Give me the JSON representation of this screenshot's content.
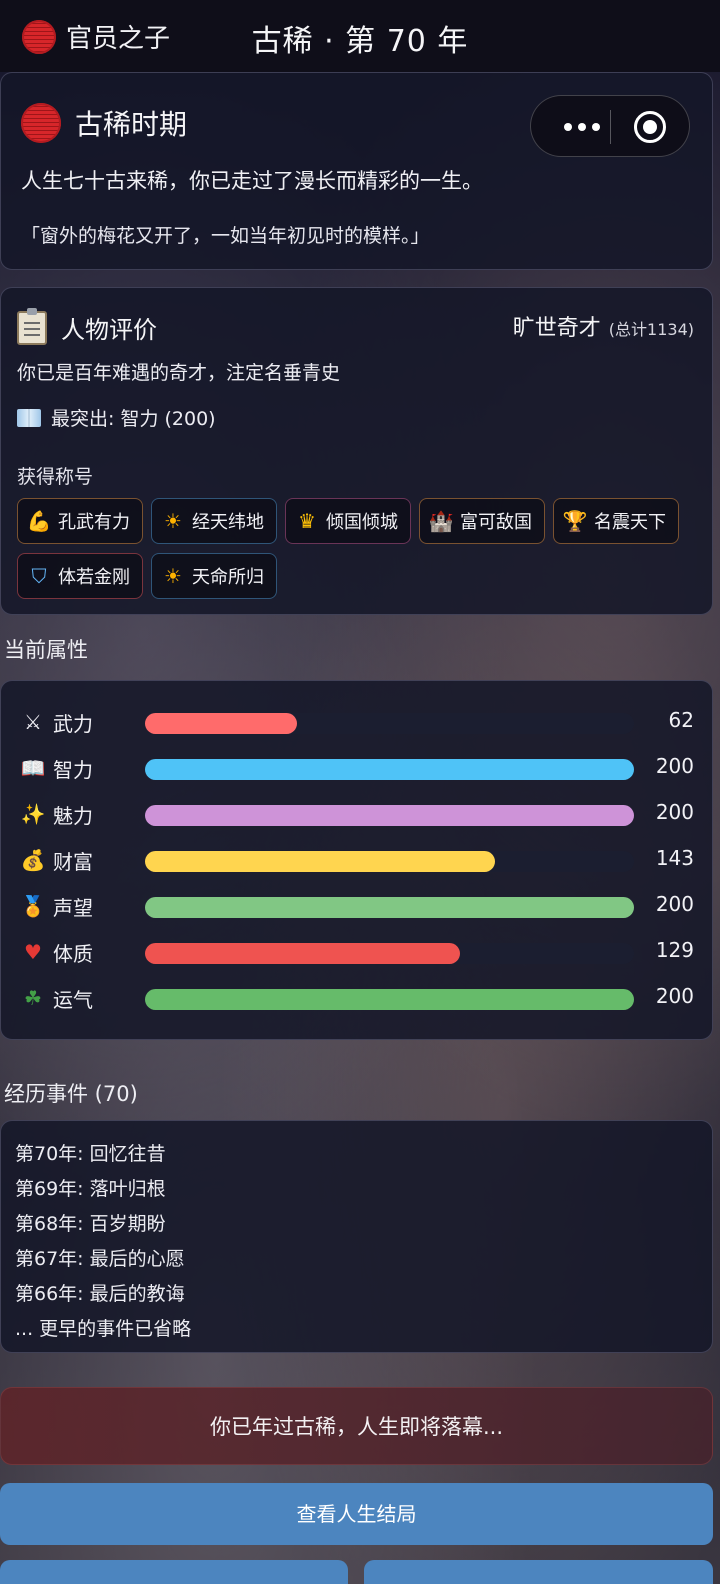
{
  "header": {
    "role": "官员之子",
    "title": "古稀 · 第 70 年"
  },
  "stage": {
    "title": "古稀时期",
    "text": "人生七十古来稀，你已走过了漫长而精彩的一生。",
    "quote": "「窗外的梅花又开了，一如当年初见时的模样。」"
  },
  "evaluation": {
    "title": "人物评价",
    "rank": "旷世奇才",
    "total": "(总计1134)",
    "description": "你已是百年难遇的奇才，注定名垂青史",
    "best": "最突出: 智力 (200)",
    "titles_label": "获得称号",
    "badges": [
      {
        "label": "孔武有力",
        "icon": "flexed-biceps-icon",
        "border": "#6b4a2e"
      },
      {
        "label": "经天纬地",
        "icon": "sun-icon",
        "border": "#2d4a6b"
      },
      {
        "label": "倾国倾城",
        "icon": "crown-icon",
        "border": "#5b2e4a"
      },
      {
        "label": "富可敌国",
        "icon": "castle-icon",
        "border": "#6b4a2e"
      },
      {
        "label": "名震天下",
        "icon": "trophy-icon",
        "border": "#6b4a2e"
      },
      {
        "label": "体若金刚",
        "icon": "shield-icon",
        "border": "#6b2e35"
      },
      {
        "label": "天命所归",
        "icon": "sun-icon",
        "border": "#2d4a6b"
      }
    ]
  },
  "attributes": {
    "section_title": "当前属性",
    "max": 200,
    "items": [
      {
        "name": "武力",
        "value": 62,
        "icon": "crossed-swords-icon",
        "color": "#ff6b6b"
      },
      {
        "name": "智力",
        "value": 200,
        "icon": "open-book-icon",
        "color": "#4fc3f7"
      },
      {
        "name": "魅力",
        "value": 200,
        "icon": "sparkles-icon",
        "color": "#ce93d8"
      },
      {
        "name": "财富",
        "value": 143,
        "icon": "money-bag-icon",
        "color": "#ffd54f"
      },
      {
        "name": "声望",
        "value": 200,
        "icon": "medal-icon",
        "color": "#81c784"
      },
      {
        "name": "体质",
        "value": 129,
        "icon": "heart-icon",
        "color": "#ef5350"
      },
      {
        "name": "运气",
        "value": 200,
        "icon": "four-leaf-clover-icon",
        "color": "#66bb6a"
      }
    ]
  },
  "events": {
    "section_title": "经历事件 (70)",
    "items": [
      "第70年: 回忆往昔",
      "第69年: 落叶归根",
      "第68年: 百岁期盼",
      "第67年: 最后的心愿",
      "第66年: 最后的教诲",
      "... 更早的事件已省略"
    ]
  },
  "notice": "你已年过古稀，人生即将落幕...",
  "actions": {
    "view_ending": "查看人生结局"
  }
}
